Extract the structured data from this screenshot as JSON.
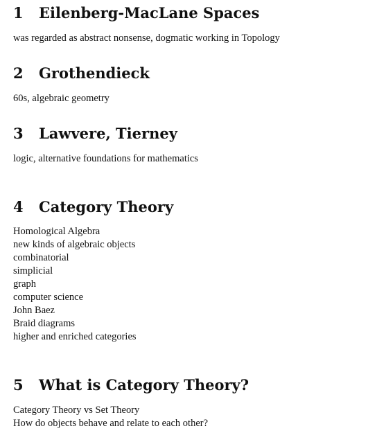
{
  "sections": [
    {
      "number": "1",
      "title": "Eilenberg-MacLane Spaces",
      "lines": [
        "was regarded as abstract nonsense, dogmatic working in Topology"
      ]
    },
    {
      "number": "2",
      "title": "Grothendieck",
      "lines": [
        "60s, algebraic geometry"
      ]
    },
    {
      "number": "3",
      "title": "Lawvere, Tierney",
      "lines": [
        "logic, alternative foundations for mathematics"
      ]
    },
    {
      "number": "4",
      "title": "Category Theory",
      "lines": [
        "Homological Algebra",
        "new kinds of algebraic objects",
        "combinatorial",
        "simplicial",
        "graph",
        "computer science",
        "John Baez",
        "Braid diagrams",
        "higher and enriched categories"
      ]
    },
    {
      "number": "5",
      "title": "What is Category Theory?",
      "lines": [
        "Category Theory vs Set Theory",
        "How do objects behave and relate to each other?"
      ]
    }
  ]
}
